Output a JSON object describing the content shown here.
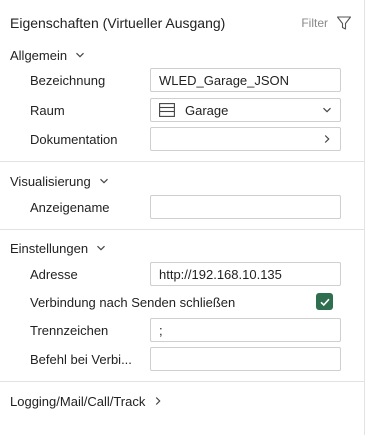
{
  "header": {
    "title": "Eigenschaften (Virtueller Ausgang)",
    "filter_label": "Filter"
  },
  "sections": {
    "allgemein": {
      "label": "Allgemein",
      "bezeichnung_label": "Bezeichnung",
      "bezeichnung_value": "WLED_Garage_JSON",
      "raum_label": "Raum",
      "raum_value": "Garage",
      "dokumentation_label": "Dokumentation",
      "dokumentation_value": ""
    },
    "visualisierung": {
      "label": "Visualisierung",
      "anzeigename_label": "Anzeigename",
      "anzeigename_value": ""
    },
    "einstellungen": {
      "label": "Einstellungen",
      "adresse_label": "Adresse",
      "adresse_value": "http://192.168.10.135",
      "verbindung_label": "Verbindung nach Senden schließen",
      "verbindung_checked": true,
      "trennzeichen_label": "Trennzeichen",
      "trennzeichen_value": ";",
      "befehl_label": "Befehl bei Verbi...",
      "befehl_value": ""
    },
    "logging": {
      "label": "Logging/Mail/Call/Track"
    }
  },
  "colors": {
    "checkbox": "#2f6e4f",
    "border": "#cfcfcf",
    "divider": "#e2e2e2"
  },
  "icons": {
    "filter": "filter-funnel-icon",
    "room": "room-table-icon",
    "collapse": "chevron-down-icon",
    "expand": "chevron-right-icon"
  }
}
